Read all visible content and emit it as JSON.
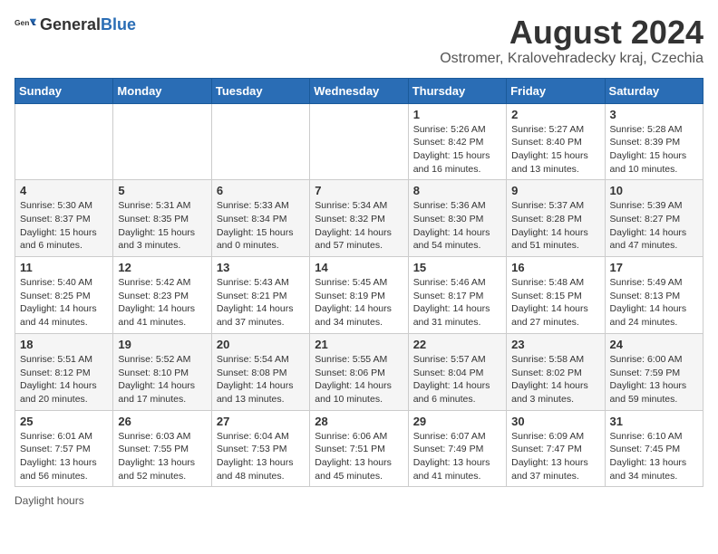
{
  "header": {
    "logo_general": "General",
    "logo_blue": "Blue",
    "month_year": "August 2024",
    "location": "Ostromer, Kralovehradecky kraj, Czechia"
  },
  "days_of_week": [
    "Sunday",
    "Monday",
    "Tuesday",
    "Wednesday",
    "Thursday",
    "Friday",
    "Saturday"
  ],
  "weeks": [
    [
      {
        "day": "",
        "info": ""
      },
      {
        "day": "",
        "info": ""
      },
      {
        "day": "",
        "info": ""
      },
      {
        "day": "",
        "info": ""
      },
      {
        "day": "1",
        "info": "Sunrise: 5:26 AM\nSunset: 8:42 PM\nDaylight: 15 hours and 16 minutes."
      },
      {
        "day": "2",
        "info": "Sunrise: 5:27 AM\nSunset: 8:40 PM\nDaylight: 15 hours and 13 minutes."
      },
      {
        "day": "3",
        "info": "Sunrise: 5:28 AM\nSunset: 8:39 PM\nDaylight: 15 hours and 10 minutes."
      }
    ],
    [
      {
        "day": "4",
        "info": "Sunrise: 5:30 AM\nSunset: 8:37 PM\nDaylight: 15 hours and 6 minutes."
      },
      {
        "day": "5",
        "info": "Sunrise: 5:31 AM\nSunset: 8:35 PM\nDaylight: 15 hours and 3 minutes."
      },
      {
        "day": "6",
        "info": "Sunrise: 5:33 AM\nSunset: 8:34 PM\nDaylight: 15 hours and 0 minutes."
      },
      {
        "day": "7",
        "info": "Sunrise: 5:34 AM\nSunset: 8:32 PM\nDaylight: 14 hours and 57 minutes."
      },
      {
        "day": "8",
        "info": "Sunrise: 5:36 AM\nSunset: 8:30 PM\nDaylight: 14 hours and 54 minutes."
      },
      {
        "day": "9",
        "info": "Sunrise: 5:37 AM\nSunset: 8:28 PM\nDaylight: 14 hours and 51 minutes."
      },
      {
        "day": "10",
        "info": "Sunrise: 5:39 AM\nSunset: 8:27 PM\nDaylight: 14 hours and 47 minutes."
      }
    ],
    [
      {
        "day": "11",
        "info": "Sunrise: 5:40 AM\nSunset: 8:25 PM\nDaylight: 14 hours and 44 minutes."
      },
      {
        "day": "12",
        "info": "Sunrise: 5:42 AM\nSunset: 8:23 PM\nDaylight: 14 hours and 41 minutes."
      },
      {
        "day": "13",
        "info": "Sunrise: 5:43 AM\nSunset: 8:21 PM\nDaylight: 14 hours and 37 minutes."
      },
      {
        "day": "14",
        "info": "Sunrise: 5:45 AM\nSunset: 8:19 PM\nDaylight: 14 hours and 34 minutes."
      },
      {
        "day": "15",
        "info": "Sunrise: 5:46 AM\nSunset: 8:17 PM\nDaylight: 14 hours and 31 minutes."
      },
      {
        "day": "16",
        "info": "Sunrise: 5:48 AM\nSunset: 8:15 PM\nDaylight: 14 hours and 27 minutes."
      },
      {
        "day": "17",
        "info": "Sunrise: 5:49 AM\nSunset: 8:13 PM\nDaylight: 14 hours and 24 minutes."
      }
    ],
    [
      {
        "day": "18",
        "info": "Sunrise: 5:51 AM\nSunset: 8:12 PM\nDaylight: 14 hours and 20 minutes."
      },
      {
        "day": "19",
        "info": "Sunrise: 5:52 AM\nSunset: 8:10 PM\nDaylight: 14 hours and 17 minutes."
      },
      {
        "day": "20",
        "info": "Sunrise: 5:54 AM\nSunset: 8:08 PM\nDaylight: 14 hours and 13 minutes."
      },
      {
        "day": "21",
        "info": "Sunrise: 5:55 AM\nSunset: 8:06 PM\nDaylight: 14 hours and 10 minutes."
      },
      {
        "day": "22",
        "info": "Sunrise: 5:57 AM\nSunset: 8:04 PM\nDaylight: 14 hours and 6 minutes."
      },
      {
        "day": "23",
        "info": "Sunrise: 5:58 AM\nSunset: 8:02 PM\nDaylight: 14 hours and 3 minutes."
      },
      {
        "day": "24",
        "info": "Sunrise: 6:00 AM\nSunset: 7:59 PM\nDaylight: 13 hours and 59 minutes."
      }
    ],
    [
      {
        "day": "25",
        "info": "Sunrise: 6:01 AM\nSunset: 7:57 PM\nDaylight: 13 hours and 56 minutes."
      },
      {
        "day": "26",
        "info": "Sunrise: 6:03 AM\nSunset: 7:55 PM\nDaylight: 13 hours and 52 minutes."
      },
      {
        "day": "27",
        "info": "Sunrise: 6:04 AM\nSunset: 7:53 PM\nDaylight: 13 hours and 48 minutes."
      },
      {
        "day": "28",
        "info": "Sunrise: 6:06 AM\nSunset: 7:51 PM\nDaylight: 13 hours and 45 minutes."
      },
      {
        "day": "29",
        "info": "Sunrise: 6:07 AM\nSunset: 7:49 PM\nDaylight: 13 hours and 41 minutes."
      },
      {
        "day": "30",
        "info": "Sunrise: 6:09 AM\nSunset: 7:47 PM\nDaylight: 13 hours and 37 minutes."
      },
      {
        "day": "31",
        "info": "Sunrise: 6:10 AM\nSunset: 7:45 PM\nDaylight: 13 hours and 34 minutes."
      }
    ]
  ],
  "footer": {
    "note": "Daylight hours"
  }
}
